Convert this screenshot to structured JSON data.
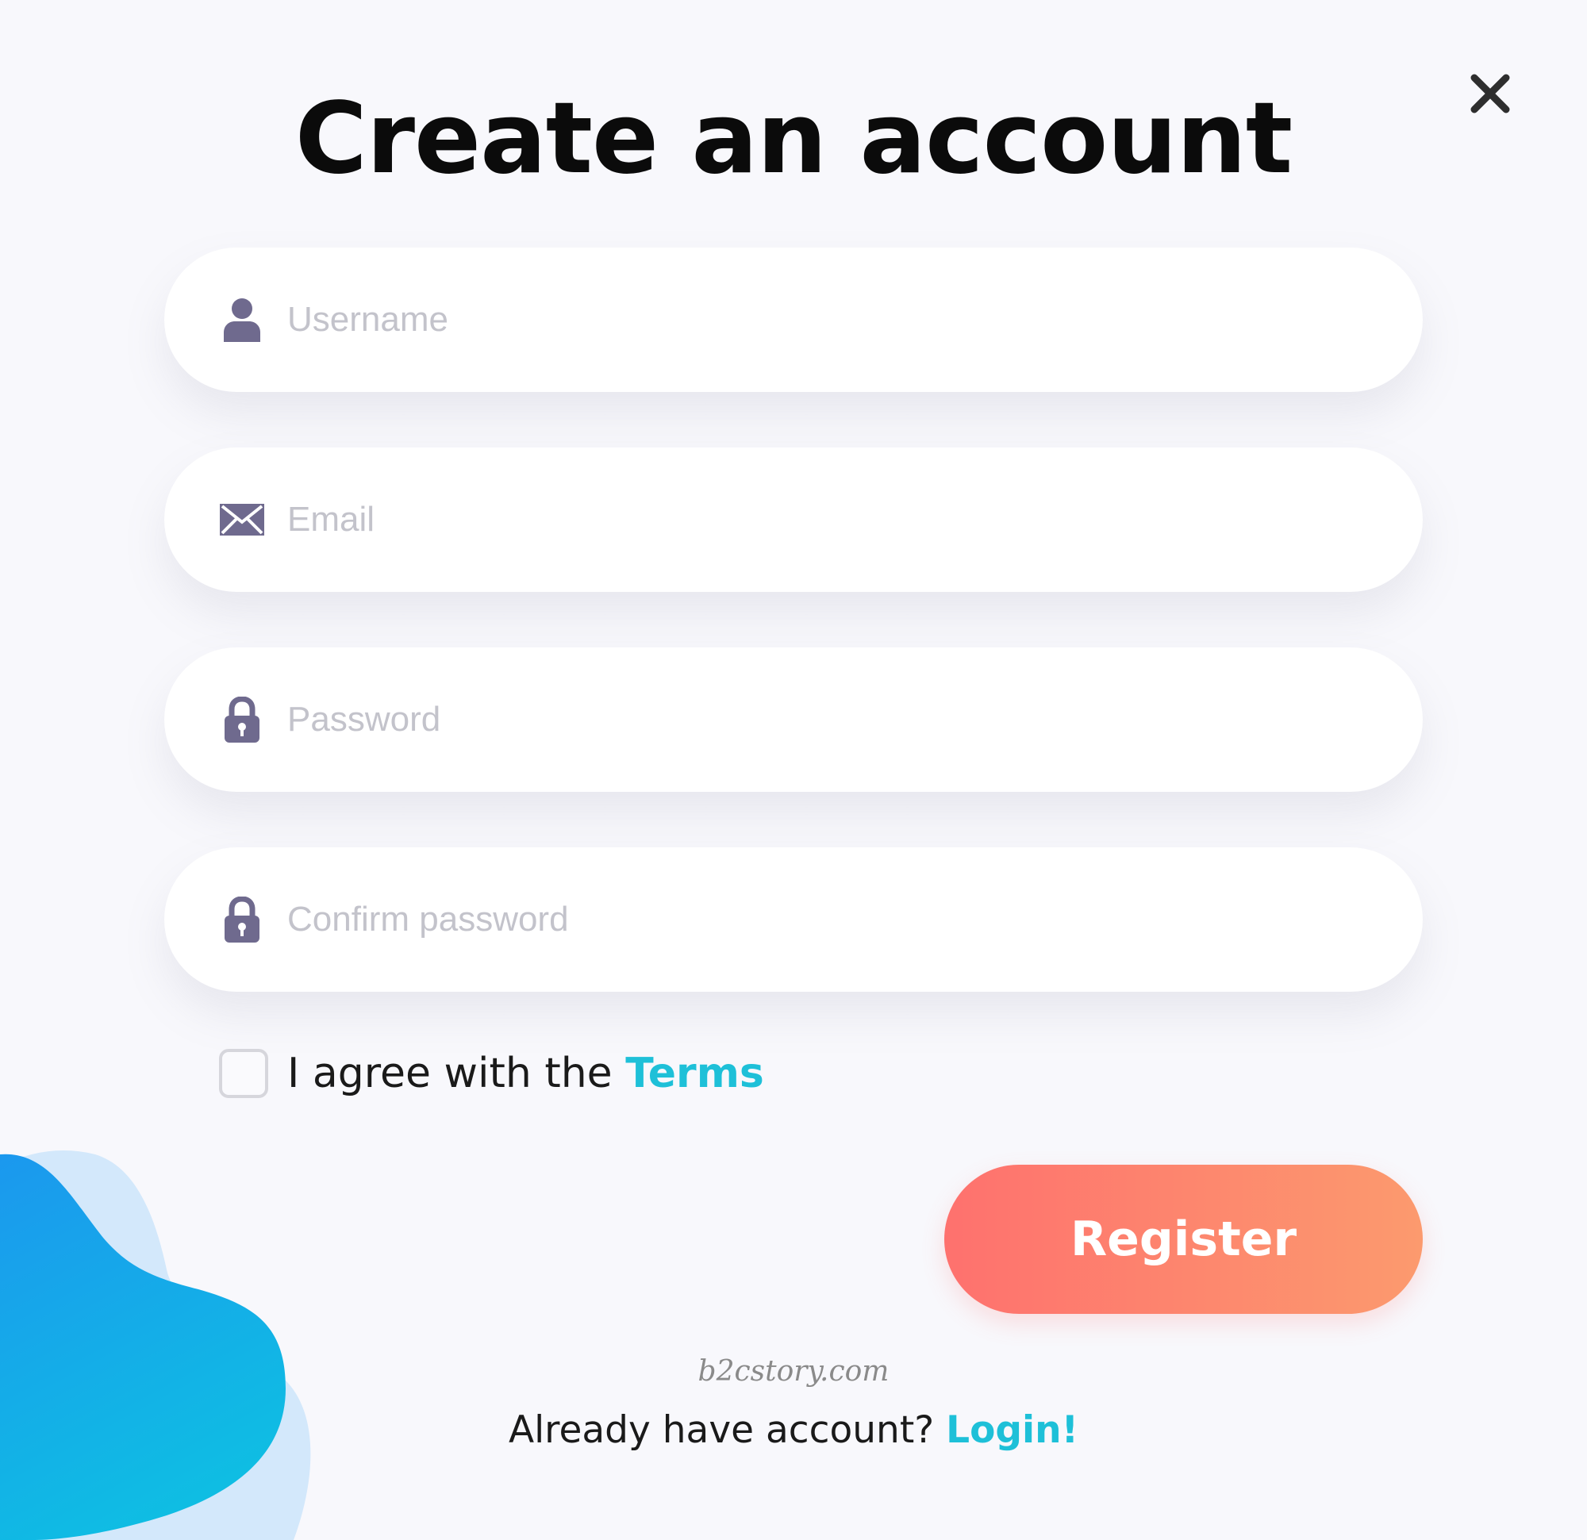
{
  "dialog": {
    "title": "Create an account",
    "close_icon": "close-icon"
  },
  "form": {
    "username": {
      "placeholder": "Username",
      "value": "",
      "icon": "user-icon"
    },
    "email": {
      "placeholder": "Email",
      "value": "",
      "icon": "envelope-icon"
    },
    "password": {
      "placeholder": "Password",
      "value": "",
      "icon": "lock-icon"
    },
    "confirm_password": {
      "placeholder": "Confirm password",
      "value": "",
      "icon": "lock-icon"
    },
    "agree": {
      "checked": false,
      "label": "I agree with the",
      "link_label": "Terms"
    },
    "register_label": "Register"
  },
  "watermark": "b2cstory.com",
  "footer": {
    "prompt": "Already have account?",
    "login_label": "Login!"
  },
  "colors": {
    "accent_link": "#1ec0d8",
    "register_gradient_start": "#fe716e",
    "register_gradient_end": "#fc9a6e",
    "icon": "#6f6a8e",
    "background": "#f8f8fc",
    "blob_light": "#d3e8fb",
    "blob_dark": "#1ba0ec"
  }
}
